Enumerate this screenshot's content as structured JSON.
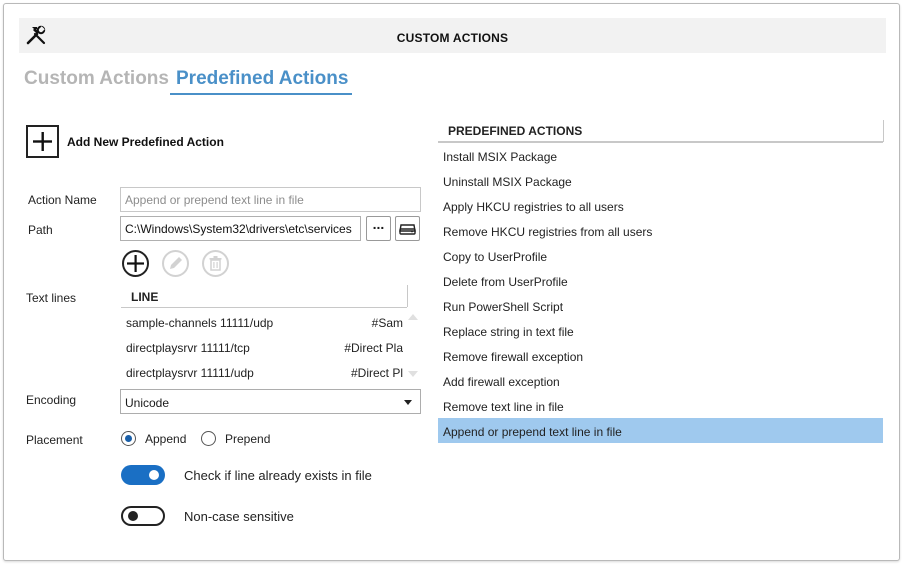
{
  "window": {
    "title": "CUSTOM ACTIONS",
    "icon": "tools-icon"
  },
  "tabs": [
    {
      "label": "Custom Actions",
      "active": false
    },
    {
      "label": "Predefined Actions",
      "active": true
    }
  ],
  "add_action": {
    "label": "Add New Predefined Action",
    "icon": "plus-icon"
  },
  "form": {
    "action_name": {
      "label": "Action Name",
      "placeholder": "Append or prepend text line in file",
      "value": ""
    },
    "path": {
      "label": "Path",
      "value": "C:\\Windows\\System32\\drivers\\etc\\services",
      "browse_label": "..."
    },
    "text_lines": {
      "label": "Text lines",
      "column_header": "LINE",
      "rows": [
        {
          "text": "sample-channels   11111/udp",
          "comment": "#Sam"
        },
        {
          "text": "directplaysrvr   11111/tcp",
          "comment": "#Direct Pla"
        },
        {
          "text": "directplaysrvr   11111/udp",
          "comment": "#Direct Pl"
        }
      ]
    },
    "encoding": {
      "label": "Encoding",
      "value": "Unicode"
    },
    "placement": {
      "label": "Placement",
      "options": [
        "Append",
        "Prepend"
      ],
      "selected": "Append"
    },
    "check_exists": {
      "label": "Check if line already exists in file",
      "on": true
    },
    "non_case_sensitive": {
      "label": "Non-case sensitive",
      "on": false
    }
  },
  "predefined_actions": {
    "header": "PREDEFINED ACTIONS",
    "items": [
      "Install MSIX Package",
      "Uninstall MSIX Package",
      "Apply HKCU registries to all users",
      "Remove HKCU registries from all users",
      "Copy to UserProfile",
      "Delete from UserProfile",
      "Run PowerShell Script",
      "Replace string in text file",
      "Remove firewall exception",
      "Add firewall exception",
      "Remove text line in file",
      "Append or prepend text line in file"
    ],
    "selected_index": 11
  },
  "colors": {
    "accent": "#4a90c8",
    "selection": "#9fc9ee",
    "toggle_on": "#1a6fc4"
  }
}
